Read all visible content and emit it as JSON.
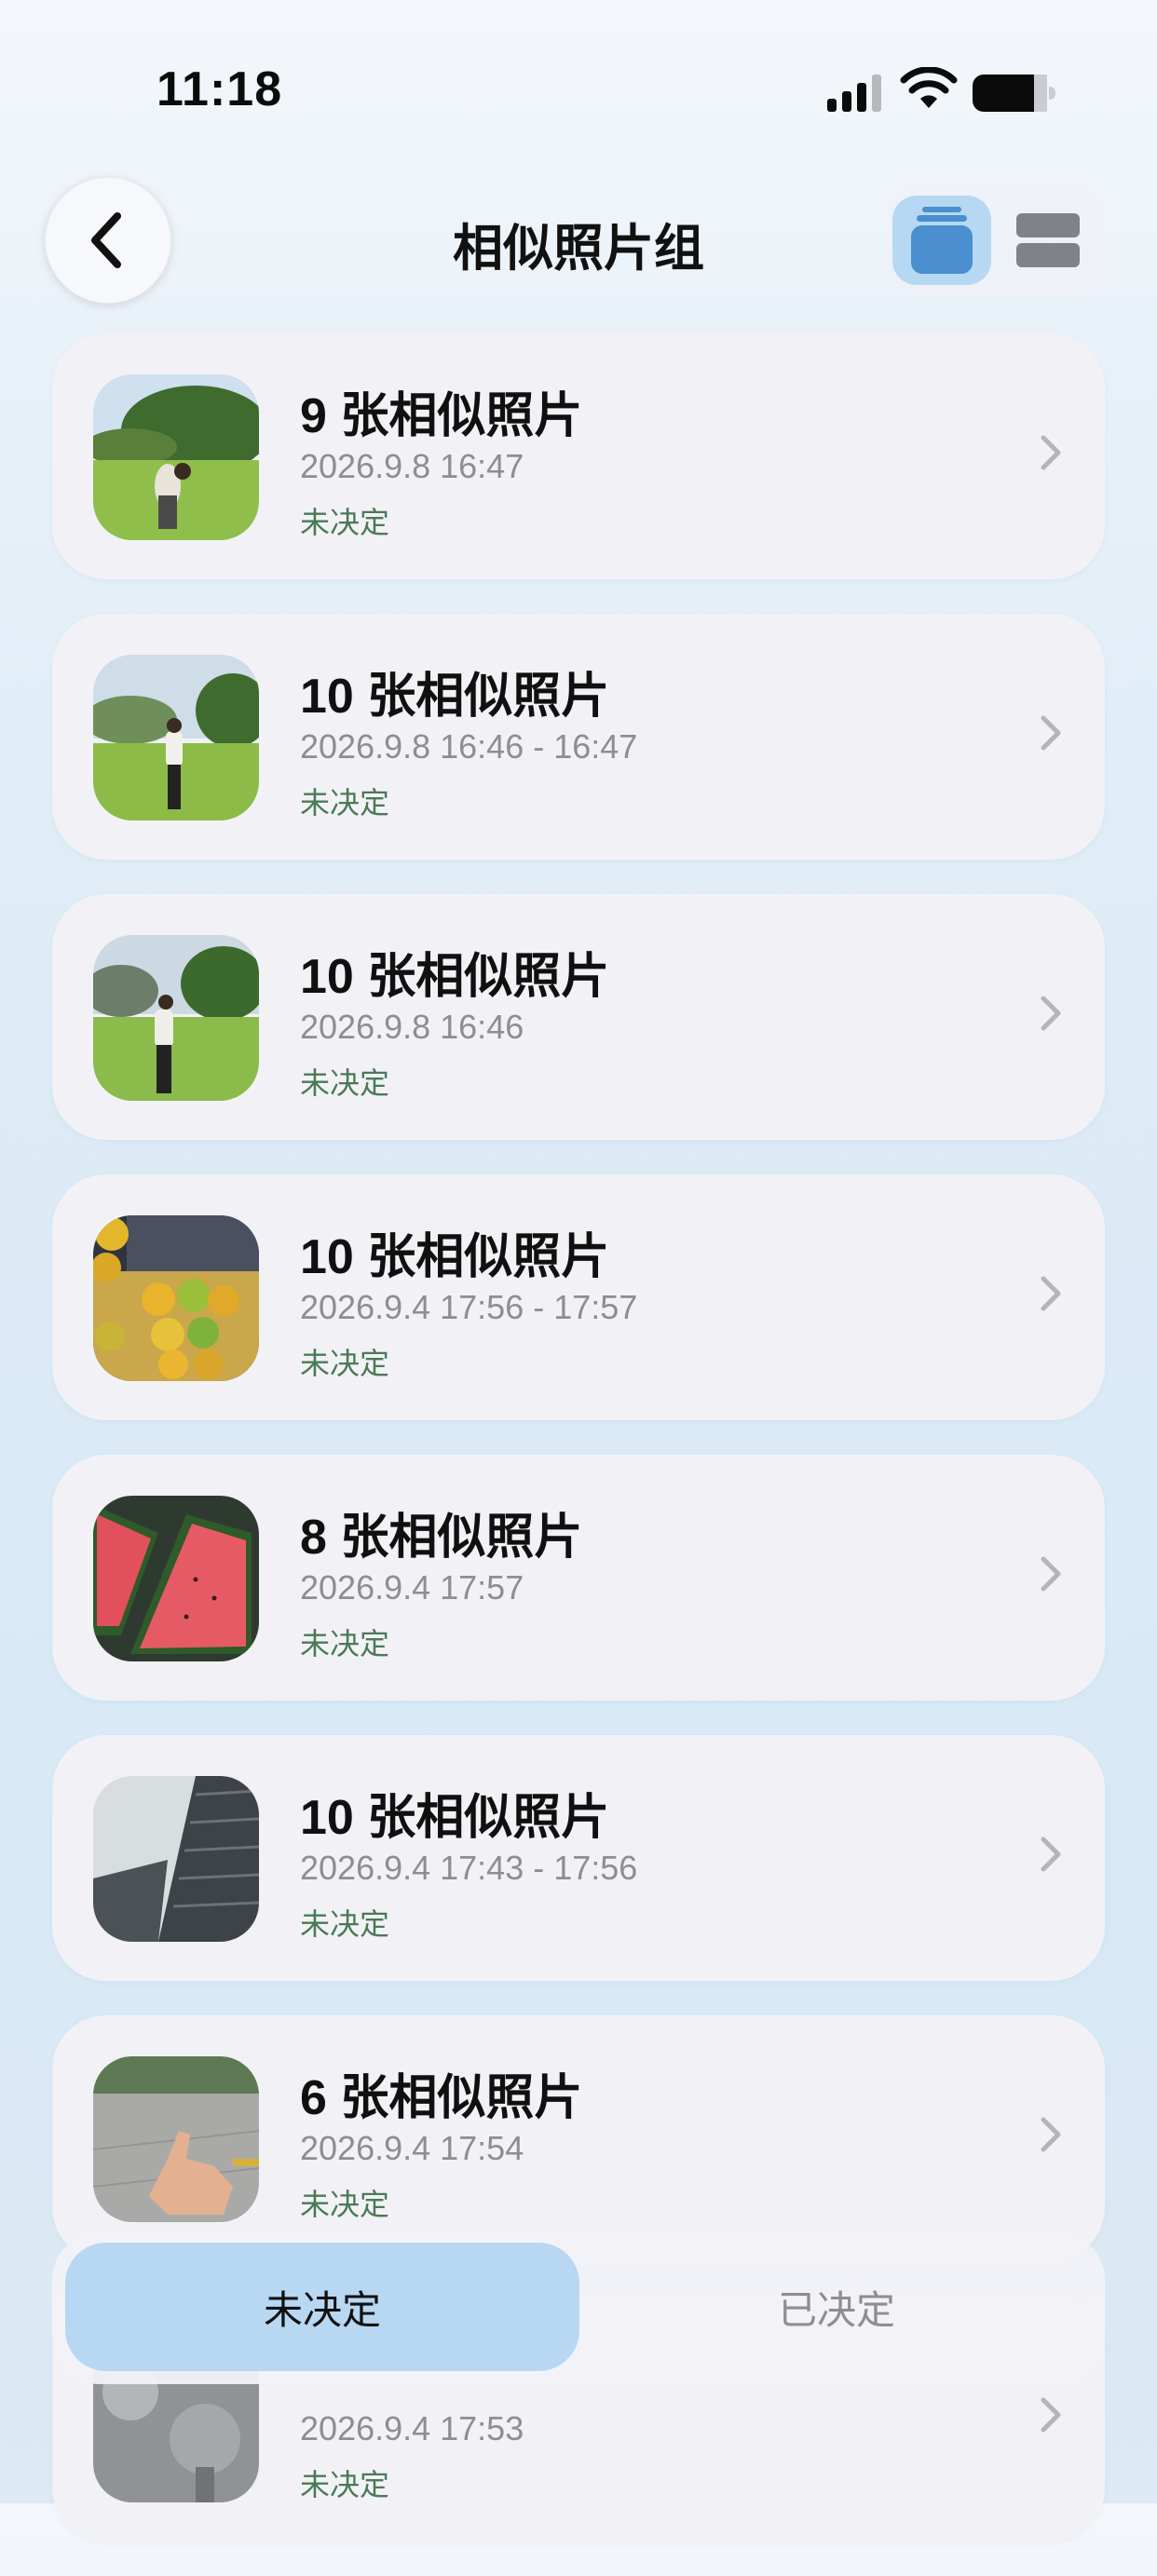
{
  "status_bar": {
    "time": "11:18",
    "icons": [
      "cellular-signal-icon",
      "wifi-icon",
      "battery-icon"
    ]
  },
  "nav": {
    "back_icon": "chevron-left-icon",
    "title": "相似照片组",
    "view_modes": [
      {
        "name": "stack-view-icon",
        "selected": true
      },
      {
        "name": "list-view-icon",
        "selected": false
      }
    ]
  },
  "groups": [
    {
      "title": "9 张相似照片",
      "time": "2026.9.8 16:47",
      "status": "未决定",
      "thumb": "park-photo"
    },
    {
      "title": "10 张相似照片",
      "time": "2026.9.8 16:46 - 16:47",
      "status": "未决定",
      "thumb": "park-photo"
    },
    {
      "title": "10 张相似照片",
      "time": "2026.9.8 16:46",
      "status": "未决定",
      "thumb": "park-photo"
    },
    {
      "title": "10 张相似照片",
      "time": "2026.9.4 17:56 - 17:57",
      "status": "未决定",
      "thumb": "oranges-photo"
    },
    {
      "title": "8 张相似照片",
      "time": "2026.9.4 17:57",
      "status": "未决定",
      "thumb": "watermelon-photo"
    },
    {
      "title": "10 张相似照片",
      "time": "2026.9.4 17:43 - 17:56",
      "status": "未决定",
      "thumb": "building-photo"
    },
    {
      "title": "6 张相似照片",
      "time": "2026.9.4 17:54",
      "status": "未决定",
      "thumb": "thumbs-up-photo"
    },
    {
      "title": "",
      "time": "2026.9.4 17:53",
      "status": "未决定",
      "thumb": "bollards-photo"
    }
  ],
  "segments": {
    "undecided": "未决定",
    "decided": "已决定",
    "selected": "undecided"
  },
  "colors": {
    "selected_segment": "#b7d7f3",
    "status_text": "#4a7a56",
    "accent_blue": "#4a8fcf"
  }
}
